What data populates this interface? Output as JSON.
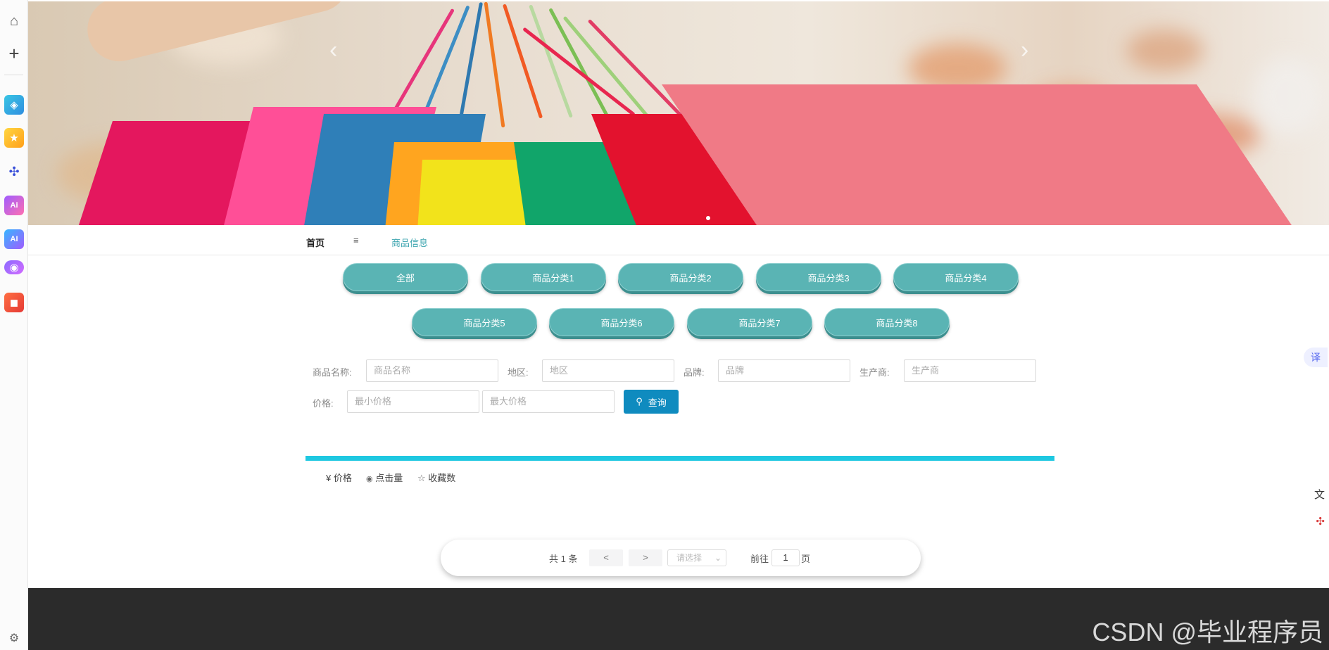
{
  "sidebar": {
    "icons": [
      "home-icon",
      "plus-icon",
      "app-icon-1",
      "star-icon",
      "network-icon",
      "ai-icon-1",
      "ai-icon-2",
      "chat-icon",
      "game-icon",
      "gear-icon"
    ],
    "ai_label_1": "Ai",
    "ai_label_2": "AI"
  },
  "banner": {
    "prev_arrow": "‹",
    "next_arrow": "›",
    "slide_count": 1,
    "active_slide": 1
  },
  "nav": {
    "home": "首页",
    "separator": "≡",
    "current": "商品信息"
  },
  "categories": [
    "全部",
    "商品分类1",
    "商品分类2",
    "商品分类3",
    "商品分类4",
    "商品分类5",
    "商品分类6",
    "商品分类7",
    "商品分类8"
  ],
  "search": {
    "name_label": "商品名称:",
    "name_placeholder": "商品名称",
    "region_label": "地区:",
    "region_placeholder": "地区",
    "brand_label": "品牌:",
    "brand_placeholder": "品牌",
    "maker_label": "生产商:",
    "maker_placeholder": "生产商",
    "price_label": "价格:",
    "min_price_placeholder": "最小价格",
    "max_price_placeholder": "最大价格",
    "query_button": "查询"
  },
  "sort": {
    "price": "¥ 价格",
    "clicks": "点击量",
    "favorites": "收藏数"
  },
  "pagination": {
    "total": "共 1 条",
    "prev": "<",
    "next": ">",
    "size_placeholder": "请选择",
    "goto_label": "前往",
    "page_value": "1",
    "page_suffix": "页"
  },
  "watermark": "CSDN @毕业程序员",
  "colors": {
    "accent": "#5ab4b4",
    "query_button": "#0f8bbf",
    "divider_bar": "#1ec8e1",
    "footer": "#2b2b2b"
  }
}
